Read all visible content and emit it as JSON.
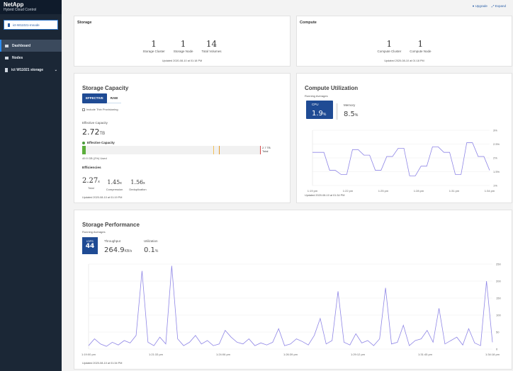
{
  "brand": {
    "name": "NetApp",
    "subtitle": "Hybrid Cloud Control"
  },
  "sidebar": {
    "cluster": "ict-W11021-mnode",
    "items": [
      {
        "label": "Dashboard",
        "active": true
      },
      {
        "label": "Nodes"
      },
      {
        "label": "ict W11021 storage"
      }
    ]
  },
  "header": {
    "upgrade": "Upgrade",
    "expand": "Expand"
  },
  "storage": {
    "title": "Storage",
    "stats": [
      {
        "value": "1",
        "label": "Storage Cluster"
      },
      {
        "value": "1",
        "label": "Storage Node"
      },
      {
        "value": "14",
        "label": "Total Volumes"
      }
    ],
    "updated": "Updated 2020-08-10 at 01:18 PM"
  },
  "compute": {
    "title": "Compute",
    "stats": [
      {
        "value": "1",
        "label": "Compute Cluster"
      },
      {
        "value": "1",
        "label": "Compute Node"
      }
    ],
    "updated": "Updated 2020-08-10 at 01:18 PM"
  },
  "capacity": {
    "title": "Storage Capacity",
    "tabs": [
      "EFFECTIVE",
      "RAW"
    ],
    "thin_label": "Include Thin Provisioning",
    "eff_label": "Effective Capacity",
    "eff_value": "2.72",
    "eff_unit": "TB",
    "bar_label": "Effective Capacity",
    "used_pct": 2,
    "total_value": "2.7 TB",
    "total_label": "Total",
    "used_text": "49.9 GB (2%) Used",
    "eff_title": "Efficiencies",
    "efficiencies": [
      {
        "value": "2.27",
        "unit": "x",
        "label": "Total"
      },
      {
        "value": "1.45",
        "unit": "x",
        "label": "Compression"
      },
      {
        "value": "1.56",
        "unit": "x",
        "label": "Deduplication"
      }
    ],
    "updated": "Updated 2020-08-10 at 01:19 PM"
  },
  "compute_util": {
    "title": "Compute Utilization",
    "subtitle": "Running Averages",
    "cpu_label": "CPU",
    "cpu_value": "1.9",
    "cpu_unit": "%",
    "mem_label": "Memory",
    "mem_value": "8.5",
    "mem_unit": "%",
    "updated": "Updated 2020-08-10 at 01:34 PM"
  },
  "perf": {
    "title": "Storage Performance",
    "subtitle": "Running Averages",
    "iops_label": "IOPS",
    "iops_value": "44",
    "tp_label": "Throughput",
    "tp_value": "264.9",
    "tp_unit": "KB/s",
    "util_label": "Utilization",
    "util_value": "0.1",
    "util_unit": "%",
    "updated": "Updated 2020-08-10 at 01:34 PM"
  },
  "chart_data": [
    {
      "type": "line",
      "name": "cpu",
      "ylim": [
        1,
        3
      ],
      "yticks": [
        "3%",
        "2.5%",
        "2%",
        "1.5%",
        "1%"
      ],
      "xticks": [
        "1:19 pm",
        "1:22 pm",
        "1:25 pm",
        "1:28 pm",
        "1:31 pm",
        "1:34 pm"
      ],
      "values": [
        2.2,
        2.2,
        2.2,
        1.55,
        1.55,
        1.4,
        1.4,
        2.3,
        2.3,
        2.1,
        2.1,
        1.55,
        1.55,
        2.05,
        2.05,
        2.35,
        2.35,
        1.35,
        1.35,
        1.7,
        1.7,
        2.4,
        2.4,
        2.2,
        2.2,
        1.4,
        1.4,
        2.55,
        2.55,
        2.05,
        2.05,
        1.55
      ]
    },
    {
      "type": "line",
      "name": "iops",
      "ylim": [
        0,
        250
      ],
      "yticks": [
        "250",
        "200",
        "150",
        "100",
        "50",
        "0"
      ],
      "xticks": [
        "1:19:00 pm",
        "1:21:33 pm",
        "1:24:06 pm",
        "1:26:39 pm",
        "1:29:12 pm",
        "1:31:45 pm",
        "1:34:18 pm"
      ],
      "values": [
        10,
        30,
        15,
        8,
        20,
        12,
        25,
        18,
        40,
        230,
        20,
        10,
        35,
        15,
        245,
        30,
        10,
        20,
        40,
        15,
        25,
        10,
        15,
        55,
        35,
        20,
        15,
        30,
        10,
        18,
        12,
        20,
        60,
        10,
        15,
        30,
        22,
        12,
        40,
        90,
        15,
        25,
        170,
        20,
        12,
        45,
        18,
        25,
        10,
        30,
        180,
        15,
        20,
        70,
        10,
        25,
        30,
        55,
        20,
        120,
        15,
        25,
        35,
        12,
        60,
        18,
        10,
        200,
        20
      ]
    }
  ]
}
